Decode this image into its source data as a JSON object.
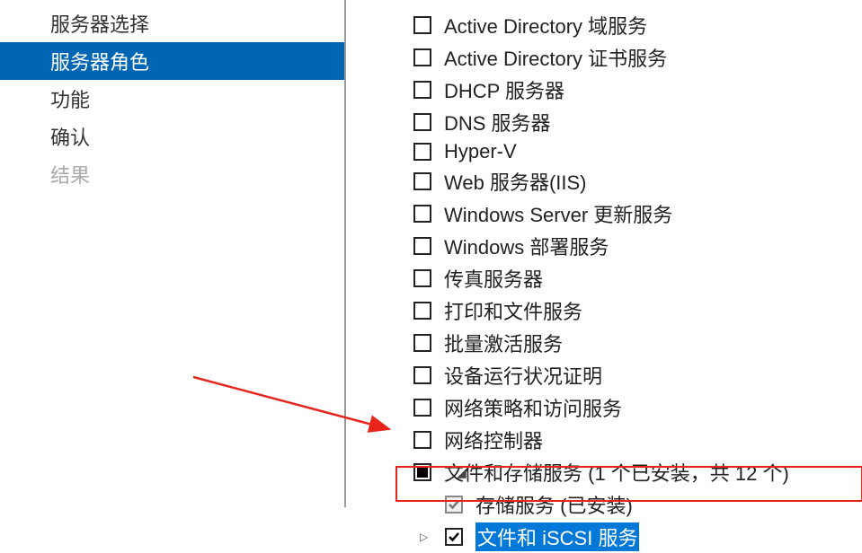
{
  "sidebar": {
    "items": [
      {
        "label": "服务器选择",
        "active": false,
        "disabled": false
      },
      {
        "label": "服务器角色",
        "active": true,
        "disabled": false
      },
      {
        "label": "功能",
        "active": false,
        "disabled": false
      },
      {
        "label": "确认",
        "active": false,
        "disabled": false
      },
      {
        "label": "结果",
        "active": false,
        "disabled": true
      }
    ]
  },
  "roles": {
    "items": [
      {
        "label": "Active Directory 域服务",
        "checked": false
      },
      {
        "label": "Active Directory 证书服务",
        "checked": false
      },
      {
        "label": "DHCP 服务器",
        "checked": false
      },
      {
        "label": "DNS 服务器",
        "checked": false
      },
      {
        "label": "Hyper-V",
        "checked": false
      },
      {
        "label": "Web 服务器(IIS)",
        "checked": false
      },
      {
        "label": "Windows Server 更新服务",
        "checked": false
      },
      {
        "label": "Windows 部署服务",
        "checked": false
      },
      {
        "label": "传真服务器",
        "checked": false
      },
      {
        "label": "打印和文件服务",
        "checked": false
      },
      {
        "label": "批量激活服务",
        "checked": false
      },
      {
        "label": "设备运行状况证明",
        "checked": false
      },
      {
        "label": "网络策略和访问服务",
        "checked": false
      },
      {
        "label": "网络控制器",
        "checked": false
      }
    ],
    "expandable": {
      "label": "文件和存储服务 (1 个已安装，共 12 个)",
      "children": [
        {
          "label": "存储服务 (已安装)",
          "state": "checked-gray"
        },
        {
          "label": "文件和 iSCSI 服务",
          "state": "checked",
          "selected": true,
          "expandable": true
        }
      ]
    }
  }
}
